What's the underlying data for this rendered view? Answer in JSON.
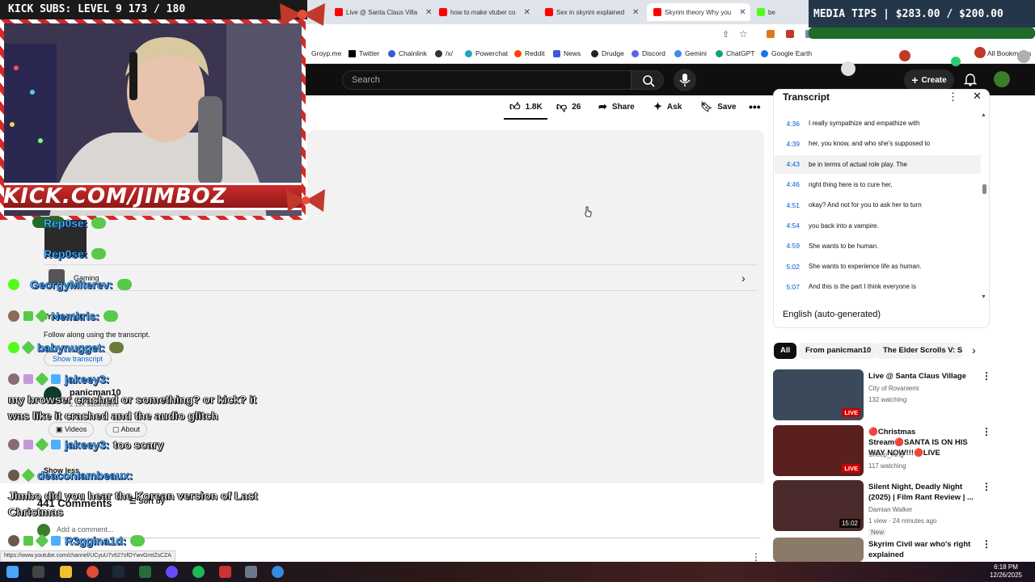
{
  "browser": {
    "tabs": [
      {
        "title": "Live @ Santa Claus Villa",
        "color": "#ff0000",
        "active": false
      },
      {
        "title": "how to make vtuber co",
        "color": "#ff0000",
        "active": false
      },
      {
        "title": "Sex in skyrim explained",
        "color": "#ff0000",
        "active": false
      },
      {
        "title": "Skyrim theory Why you",
        "color": "#ff0000",
        "active": true
      },
      {
        "title": "be",
        "color": "#53fc18",
        "active": false
      }
    ],
    "bookmarks": [
      {
        "label": "Groyp.me",
        "color": "#7b5cff"
      },
      {
        "label": "Twitter",
        "color": "#000000"
      },
      {
        "label": "Chainlink",
        "color": "#375bd2"
      },
      {
        "label": "/x/",
        "color": "#333333"
      },
      {
        "label": "Powerchat",
        "color": "#20a8c0"
      },
      {
        "label": "Reddit",
        "color": "#ff4500"
      },
      {
        "label": "News",
        "color": "#3b5bdb"
      },
      {
        "label": "Drudge",
        "color": "#222222"
      },
      {
        "label": "Discord",
        "color": "#5865f2"
      },
      {
        "label": "Gemini",
        "color": "#4285f4"
      },
      {
        "label": "ChatGPT",
        "color": "#10a37f"
      },
      {
        "label": "Google Earth",
        "color": "#1a73e8"
      }
    ],
    "all_bookmarks_label": "All Bookmarks"
  },
  "youtube": {
    "search_placeholder": "Search",
    "create_label": "Create",
    "actions": {
      "likes": "1.8K",
      "dislikes": "26",
      "share": "Share",
      "ask": "Ask",
      "save": "Save"
    },
    "description": {
      "chat_name_1": "Rep0se:",
      "category": "Gaming",
      "transcript_heading": "Transcript",
      "transcript_note": "Follow along using the transcript.",
      "show_transcript": "Show transcript",
      "channel": "panicman10",
      "subscribers": "2.13K subscribers",
      "videos_label": "Videos",
      "about_label": "About",
      "show_less": "Show less"
    },
    "comments": {
      "count_label": "441 Comments",
      "sort_label": "Sort by",
      "add_placeholder": "Add a comment..."
    },
    "status_url": "https://www.youtube.com/channel/UCyuU7v627sfOYwvGmtZsCZA"
  },
  "transcript_panel": {
    "title": "Transcript",
    "language": "English (auto-generated)",
    "segments": [
      {
        "time": "4:36",
        "text": "I really sympathize and empathize with",
        "active": false
      },
      {
        "time": "4:39",
        "text": "her, you know, and who she's supposed to",
        "active": false
      },
      {
        "time": "4:43",
        "text": "be in terms of actual role play. The",
        "active": true
      },
      {
        "time": "4:46",
        "text": "right thing here is to cure her,",
        "active": false
      },
      {
        "time": "4:51",
        "text": "okay? And not for you to ask her to turn",
        "active": false
      },
      {
        "time": "4:54",
        "text": "you back into a vampire.",
        "active": false
      },
      {
        "time": "4:59",
        "text": "She wants to be human.",
        "active": false
      },
      {
        "time": "5:02",
        "text": "She wants to experience life as human.",
        "active": false
      },
      {
        "time": "5:07",
        "text": "And this is the part I think everyone is",
        "active": false
      }
    ]
  },
  "chips": [
    {
      "label": "All",
      "active": true
    },
    {
      "label": "From panicman10",
      "active": false
    },
    {
      "label": "The Elder Scrolls V: Sk",
      "active": false
    }
  ],
  "recommendations": [
    {
      "title": "Live @ Santa Claus Village",
      "channel": "City of Rovaniemi",
      "meta": "132 watching",
      "badge": "LIVE",
      "badge_type": "live",
      "thumb_color": "#3a4a5a"
    },
    {
      "title": "🔴Christmas Stream🔴SANTA IS ON HIS WAY NOW!!!🔴LIVE",
      "channel": "Sheep_Xing",
      "meta": "117 watching",
      "badge": "LIVE",
      "badge_type": "live",
      "thumb_color": "#5a2020"
    },
    {
      "title": "Silent Night, Deadly Night (2025) | Film Rant Review | ...",
      "channel": "Damian Walker",
      "meta": "1 view · 24 minutes ago",
      "extra": "New",
      "badge": "15:02",
      "badge_type": "dur",
      "thumb_color": "#4a2a2a"
    },
    {
      "title": "Skyrim Civil war who's right explained",
      "channel": "",
      "meta": "",
      "badge": "",
      "badge_type": "",
      "thumb_color": "#8a7a6a"
    }
  ],
  "overlay": {
    "kick_subs": "KICK SUBS: LEVEL 9 173 / 180",
    "media_tips": "MEDIA TIPS | $283.00 / $200.00",
    "webcam_banner": "KICK.COM/JIMBOZ",
    "chat": [
      {
        "name": "Rep0se:",
        "message": ""
      },
      {
        "name": "GeorgyMiterev:",
        "message": ""
      },
      {
        "name": "Nemkris:",
        "message": ""
      },
      {
        "name": "babynugget:",
        "message": ""
      },
      {
        "name": "jakeey3:",
        "message": ""
      },
      {
        "name": "jakeey3:",
        "message": "too scary"
      },
      {
        "name": "deaconlambeaux:",
        "message": ""
      },
      {
        "name": "R3ggina1d:",
        "message": ""
      }
    ],
    "long_messages": {
      "jakeey3": "my browser crashed or something? or kick? it was like it crashed and the audio glitch",
      "deacon": "Jimbo did you hear the Korean version of Last Christmas"
    }
  },
  "taskbar": {
    "time": "6:18 PM",
    "date": "12/26/2025"
  }
}
